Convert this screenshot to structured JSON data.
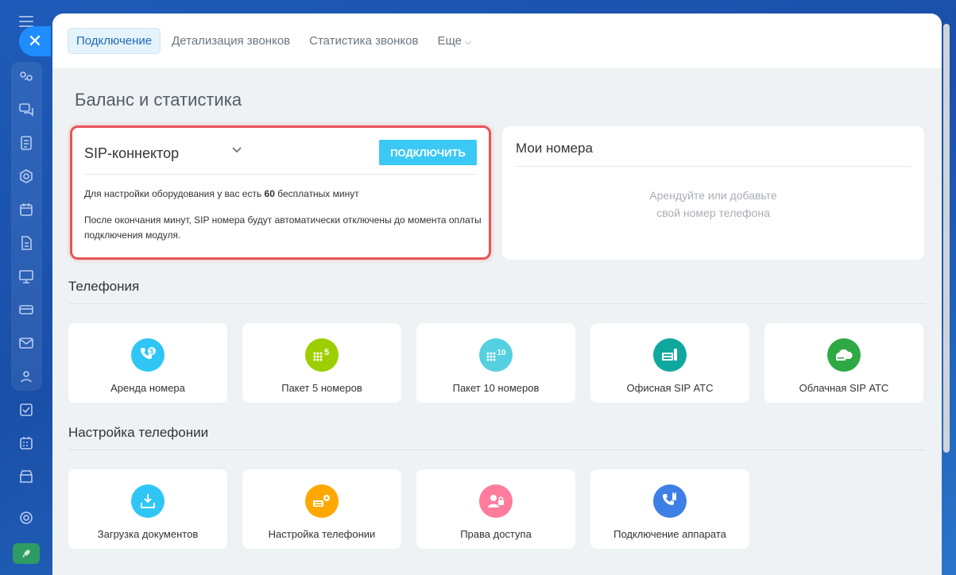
{
  "tabs": {
    "connection": "Подключение",
    "call_details": "Детализация звонков",
    "call_stats": "Статистика звонков",
    "more": "Еще"
  },
  "page_title": "Баланс и статистика",
  "sip": {
    "name": "SIP-коннектор",
    "button": "ПОДКЛЮЧИТЬ",
    "text1_prefix": "Для настройки оборудования у вас есть ",
    "text1_value": "60",
    "text1_suffix": " бесплатных минут",
    "text2": "После окончания минут, SIP номера будут автоматически отключены до момента оплаты подключения модуля."
  },
  "my_numbers": {
    "title": "Мои номера",
    "placeholder_line1": "Арендуйте или добавьте",
    "placeholder_line2": "свой номер телефона"
  },
  "sections": {
    "telephony": "Телефония",
    "telephony_settings": "Настройка телефонии"
  },
  "telephony_tiles": [
    {
      "label": "Аренда номера",
      "icon": "phone-rent-icon",
      "color": "#2fc6f6"
    },
    {
      "label": "Пакет 5 номеров",
      "icon": "pack-5-icon",
      "color": "#9dcf00"
    },
    {
      "label": "Пакет 10 номеров",
      "icon": "pack-10-icon",
      "color": "#55d0e0"
    },
    {
      "label": "Офисная SIP АТС",
      "icon": "office-pbx-icon",
      "color": "#0fa89e"
    },
    {
      "label": "Облачная SIP АТС",
      "icon": "cloud-pbx-icon",
      "color": "#2ea944"
    }
  ],
  "settings_tiles": [
    {
      "label": "Загрузка документов",
      "icon": "document-download-icon",
      "color": "#2fc6f6"
    },
    {
      "label": "Настройка телефонии",
      "icon": "telephony-settings-icon",
      "color": "#ffa900"
    },
    {
      "label": "Права доступа",
      "icon": "access-rights-icon",
      "color": "#ff7c9c"
    },
    {
      "label": "Подключение аппарата",
      "icon": "device-connect-icon",
      "color": "#3d7fe6"
    }
  ],
  "colors": {
    "accent": "#3bc8f5",
    "highlight": "#e6555a"
  }
}
